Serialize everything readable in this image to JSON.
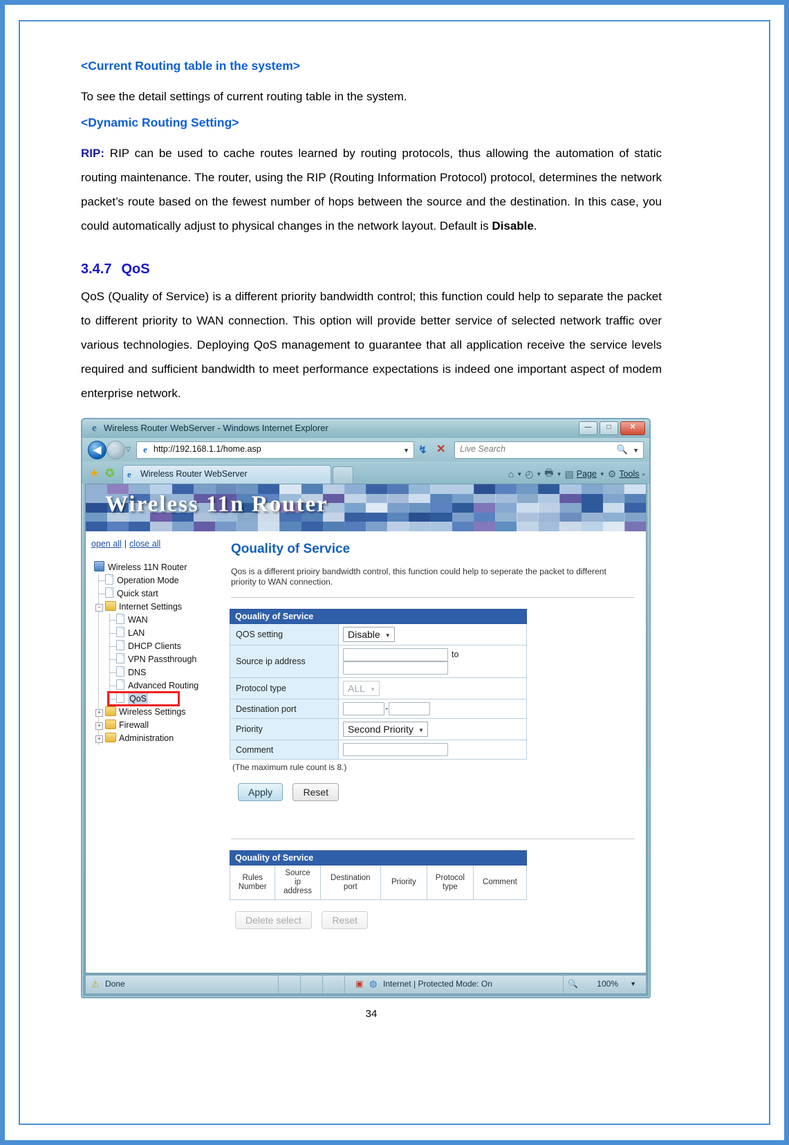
{
  "document": {
    "heading1": "<Current Routing table in the system>",
    "para1": "To see the detail settings of current routing table in the system.",
    "heading2": "<Dynamic Routing Setting>",
    "rip_label": "RIP:",
    "rip_text": " RIP can be used to cache routes learned by routing protocols, thus allowing the automation of static routing maintenance. The router, using the RIP (Routing Information Protocol) protocol, determines the network packet’s route based on the fewest number of hops between the source and the destination. In this case, you could automatically adjust to physical changes in the network layout. Default is ",
    "rip_default": "Disable",
    "rip_period": ".",
    "section_number": "3.4.7",
    "section_title": "QoS",
    "qos_para": "QoS (Quality of Service) is a different priority bandwidth control; this function could help to separate the packet to different priority to WAN connection. This option will provide better service of selected network traffic over various technologies. Deploying QoS management to guarantee that all application receive the service levels required and sufficient bandwidth to meet performance expectations is indeed one important aspect of modem enterprise network.",
    "page_number": "34"
  },
  "browser": {
    "window_title": "Wireless Router WebServer - Windows Internet Explorer",
    "ie_glyph": "e",
    "minimize_label": "—",
    "maximize_label": "□",
    "close_label": "✕",
    "back_arrow": "◀",
    "forward_arrow": "▶",
    "history_caret": "▽",
    "url": "http://192.168.1.1/home.asp",
    "url_caret": "▼",
    "refresh_icon": "↯",
    "stop_icon": "✕",
    "search_placeholder": "Live Search",
    "search_icon": "🔍",
    "search_caret": "▼",
    "favorites_star": "★",
    "favorites_add": "✪",
    "tab_label": "Wireless Router WebServer",
    "toolbar": {
      "home_icon": "⌂",
      "feeds_icon": "◴",
      "print_icon": "🖶",
      "page_label": "Page",
      "tools_label": "Tools",
      "chevrons": "»",
      "caret": "▼"
    },
    "status": {
      "warning_icon": "⚠",
      "done_text": "Done",
      "shield_icon": "▣",
      "globe_icon": "◍",
      "zone_text": "Internet | Protected Mode: On",
      "zoom_icon": "🔍",
      "zoom_level": "100%",
      "zoom_caret": "▼"
    }
  },
  "router_page": {
    "banner_brand": "Wireless 11n Router",
    "open_all": "open all",
    "separator": "|",
    "close_all": "close all",
    "tree": [
      {
        "label": "Wireless 11N Router",
        "icon": "router-icon",
        "depth": 0,
        "toggle": "none"
      },
      {
        "label": "Operation Mode",
        "icon": "doc-icon",
        "depth": 1,
        "toggle": "none"
      },
      {
        "label": "Quick start",
        "icon": "doc-icon",
        "depth": 1,
        "toggle": "none"
      },
      {
        "label": "Internet Settings",
        "icon": "folder-icon",
        "depth": 1,
        "toggle": "minus"
      },
      {
        "label": "WAN",
        "icon": "doc-icon",
        "depth": 2,
        "toggle": "none"
      },
      {
        "label": "LAN",
        "icon": "doc-icon",
        "depth": 2,
        "toggle": "none"
      },
      {
        "label": "DHCP Clients",
        "icon": "doc-icon",
        "depth": 2,
        "toggle": "none"
      },
      {
        "label": "VPN Passthrough",
        "icon": "doc-icon",
        "depth": 2,
        "toggle": "none"
      },
      {
        "label": "DNS",
        "icon": "doc-icon",
        "depth": 2,
        "toggle": "none"
      },
      {
        "label": "Advanced Routing",
        "icon": "doc-icon",
        "depth": 2,
        "toggle": "none"
      },
      {
        "label": "QoS",
        "icon": "doc-icon",
        "depth": 2,
        "toggle": "none",
        "selected": true,
        "highlighted": true
      },
      {
        "label": "Wireless Settings",
        "icon": "folder-icon",
        "depth": 1,
        "toggle": "plus"
      },
      {
        "label": "Firewall",
        "icon": "folder-icon",
        "depth": 1,
        "toggle": "plus"
      },
      {
        "label": "Administration",
        "icon": "folder-icon",
        "depth": 1,
        "toggle": "plus"
      }
    ],
    "content": {
      "title": "Qouality of Service",
      "description": "Qos is a different prioiry bandwidth control, this function could help to seperate the packet to different priority to WAN connection.",
      "form_header": "Qouality of Service",
      "rows": {
        "qos_setting_label": "QOS setting",
        "qos_setting_value": "Disable",
        "source_ip_label": "Source ip address",
        "source_ip_from": "",
        "source_ip_to_word": "to",
        "source_ip_to": "",
        "protocol_label": "Protocol type",
        "protocol_value": "ALL",
        "dest_port_label": "Destination port",
        "dest_port_from": "",
        "dest_port_sep": "-",
        "dest_port_to": "",
        "priority_label": "Priority",
        "priority_value": "Second Priority",
        "comment_label": "Comment",
        "comment_value": ""
      },
      "max_rule_note": "(The maximum rule count is 8.)",
      "apply_label": "Apply",
      "reset_label": "Reset",
      "table_header": "Qouality of Service",
      "table_columns": [
        "Rules Number",
        "Source ip address",
        "Destination port",
        "Priority",
        "Protocol type",
        "Comment"
      ],
      "delete_select_label": "Delete select",
      "table_reset_label": "Reset"
    }
  },
  "colors": {
    "accent_blue": "#1560bd",
    "heading_blue": "#0e5fd9",
    "table_header_blue": "#2f5fa8",
    "highlight_red": "#ef1f1f",
    "frame_blue": "#4a8fd4"
  }
}
